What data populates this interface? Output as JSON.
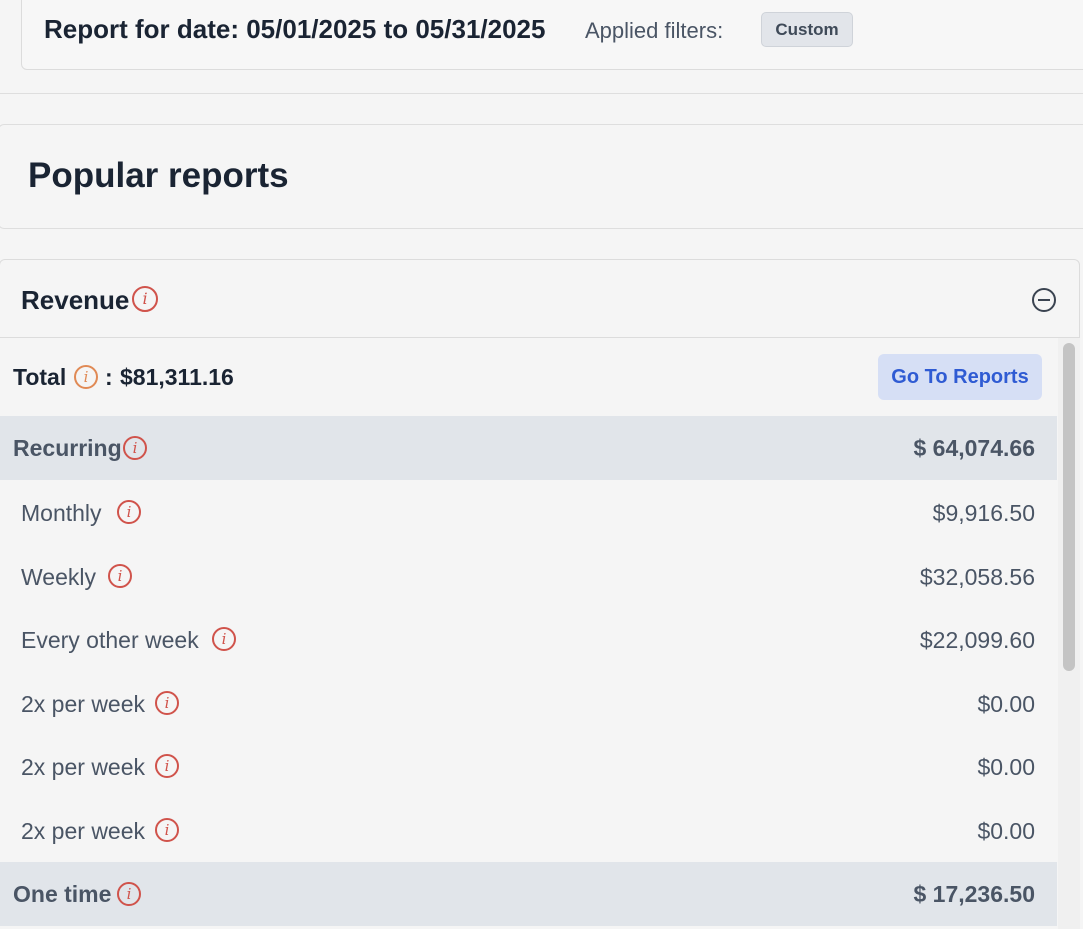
{
  "report_header": {
    "title": "Report for date: 05/01/2025 to 05/31/2025",
    "filters_label": "Applied filters:",
    "filter_chip": "Custom"
  },
  "popular": {
    "title": "Popular reports"
  },
  "revenue": {
    "title": "Revenue",
    "total_label": "Total",
    "total_separator": ":",
    "total_value": "$81,311.16",
    "goto_button": "Go To Reports",
    "groups": [
      {
        "label": "Recurring",
        "value": "$ 64,074.66",
        "items": [
          {
            "label": "Monthly",
            "value": "$9,916.50"
          },
          {
            "label": "Weekly",
            "value": "$32,058.56"
          },
          {
            "label": "Every other week",
            "value": "$22,099.60"
          },
          {
            "label": "2x per week",
            "value": "$0.00"
          },
          {
            "label": "2x per week",
            "value": "$0.00"
          },
          {
            "label": "2x per week",
            "value": "$0.00"
          }
        ]
      },
      {
        "label": "One time",
        "value": "$ 17,236.50",
        "items": []
      }
    ]
  },
  "icons": {
    "info": "info-icon",
    "collapse": "minus-circle-icon"
  },
  "colors": {
    "info_icon": "#d0534b",
    "total_info_icon": "#e08a55",
    "button_bg": "#d6dff5",
    "button_text": "#2f5bd3",
    "group_row_bg": "#e1e5ea"
  }
}
